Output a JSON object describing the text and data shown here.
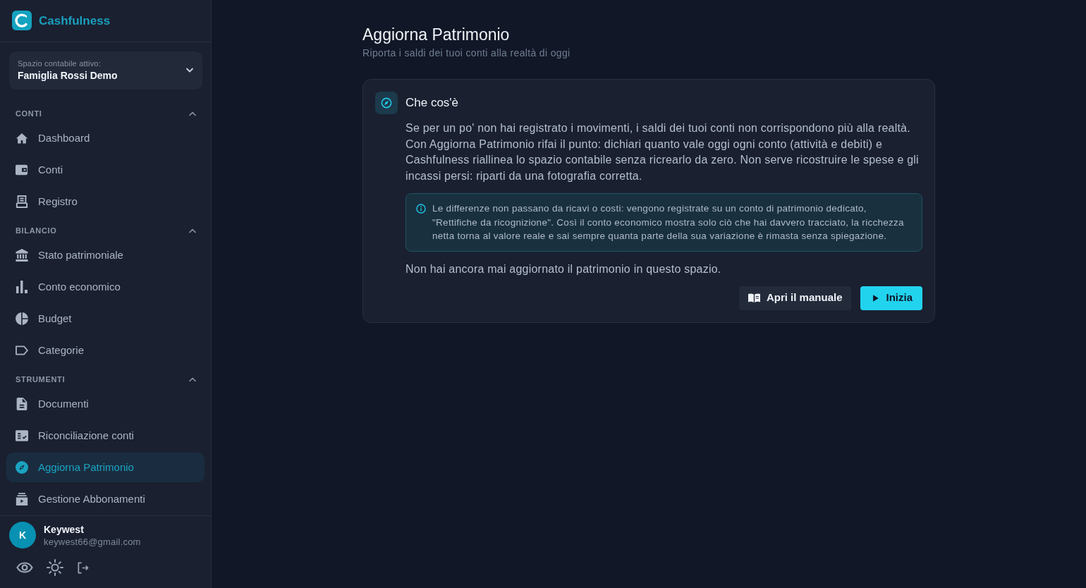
{
  "brand": {
    "name": "Cashfulness"
  },
  "workspace": {
    "label": "Spazio contabile attivo:",
    "value": "Famiglia Rossi Demo"
  },
  "sidebar": {
    "sections": [
      {
        "title": "CONTI",
        "expanded": true,
        "items": [
          {
            "label": "Dashboard",
            "selected": false
          },
          {
            "label": "Conti",
            "selected": false
          },
          {
            "label": "Registro",
            "selected": false
          }
        ]
      },
      {
        "title": "BILANCIO",
        "expanded": true,
        "items": [
          {
            "label": "Stato patrimoniale",
            "selected": false
          },
          {
            "label": "Conto economico",
            "selected": false
          },
          {
            "label": "Budget",
            "selected": false
          },
          {
            "label": "Categorie",
            "selected": false
          }
        ]
      },
      {
        "title": "STRUMENTI",
        "expanded": true,
        "items": [
          {
            "label": "Documenti",
            "selected": false
          },
          {
            "label": "Riconciliazione conti",
            "selected": false
          },
          {
            "label": "Aggiorna Patrimonio",
            "selected": true
          },
          {
            "label": "Gestione Abbonamenti",
            "selected": false
          }
        ]
      }
    ]
  },
  "user": {
    "initial": "K",
    "name": "Keywest",
    "email": "keywest66@gmail.com"
  },
  "page": {
    "title": "Aggiorna Patrimonio",
    "subtitle": "Riporta i saldi dei tuoi conti alla realtà di oggi"
  },
  "card": {
    "title": "Che cos'è",
    "body": "Se per un po' non hai registrato i movimenti, i saldi dei tuoi conti non corrispondono più alla realtà. Con Aggiorna Patrimonio rifai il punto: dichiari quanto vale oggi ogni conto (attività e debiti) e Cashfulness riallinea lo spazio contabile senza ricrearlo da zero. Non serve ricostruire le spese e gli incassi persi: riparti da una fotografia corretta.",
    "note": "Le differenze non passano da ricavi o costi: vengono registrate su un conto di patrimonio dedicato, \"Rettifiche da ricognizione\". Così il conto economico mostra solo ciò che hai davvero tracciato, la ricchezza netta torna al valore reale e sai sempre quanta parte della sua variazione è rimasta senza spiegazione.",
    "status": "Non hai ancora mai aggiornato il patrimonio in questo spazio.",
    "buttons": [
      {
        "label": "Apri il manuale",
        "kind": "secondary"
      },
      {
        "label": "Inizia",
        "kind": "primary"
      }
    ]
  }
}
